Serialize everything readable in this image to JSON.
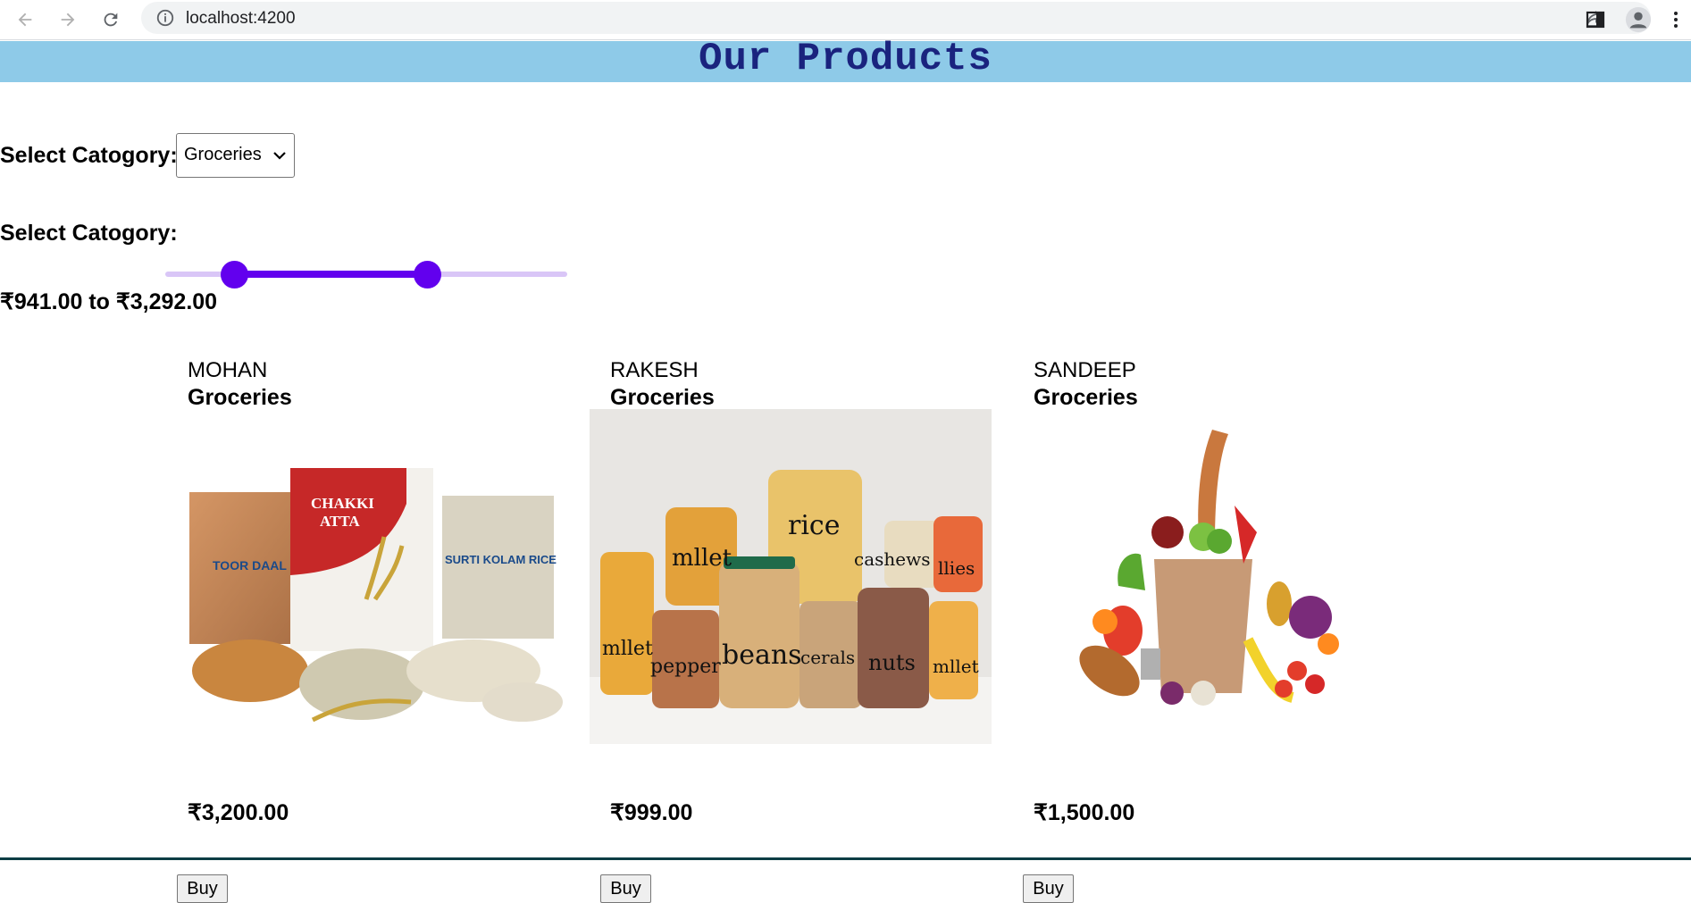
{
  "browser": {
    "url": "localhost:4200"
  },
  "page": {
    "title": "Our Products",
    "category_label": "Select Catogory:",
    "category_selected": "Groceries",
    "price_label": "Select Catogory:",
    "price_range_text": "₹941.00 to ₹3,292.00",
    "slider": {
      "min_fraction": 0.17,
      "max_fraction": 0.65
    }
  },
  "products": [
    {
      "name": "MOHAN",
      "category": "Groceries",
      "price": "₹3,200.00",
      "buy_label": "Buy",
      "image": "atta-dal-rice-packs"
    },
    {
      "name": "RAKESH",
      "category": "Groceries",
      "price": "₹999.00",
      "buy_label": "Buy",
      "image": "labelled-jars"
    },
    {
      "name": "SANDEEP",
      "category": "Groceries",
      "price": "₹1,500.00",
      "buy_label": "Buy",
      "image": "grocery-bag"
    }
  ],
  "jar_labels": [
    "mllet",
    "rice",
    "cashews",
    "llies",
    "mllet",
    "pepper",
    "beans",
    "cerals",
    "nuts",
    "mllet"
  ],
  "pack_labels": [
    "TOOR DAAL",
    "CHAKKI",
    "ATTA",
    "SURTI KOLAM RICE"
  ]
}
